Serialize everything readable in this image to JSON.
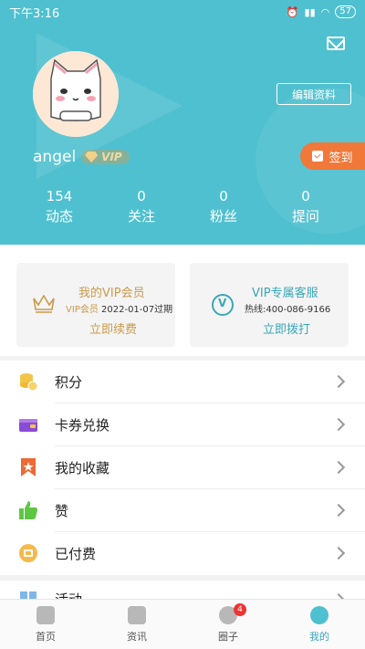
{
  "status_bar": {
    "time": "下午3:16",
    "battery": "57"
  },
  "header": {
    "edit_profile_label": "编辑资料",
    "signin_label": "签到",
    "username": "angel",
    "vip_label": "VIP",
    "stats": [
      {
        "value": "154",
        "label": "动态"
      },
      {
        "value": "0",
        "label": "关注"
      },
      {
        "value": "0",
        "label": "粉丝"
      },
      {
        "value": "0",
        "label": "提问"
      }
    ]
  },
  "vip_card": {
    "title": "我的VIP会员",
    "member_label": "VIP会员",
    "expiry": "2022-01-07过期",
    "action": "立即续费"
  },
  "service_card": {
    "title": "VIP专属客服",
    "hotline": "热线:400-086-9166",
    "action": "立即拨打"
  },
  "menu_items": [
    {
      "label": "积分",
      "icon": "coins-icon",
      "color": "#f3c44a"
    },
    {
      "label": "卡券兑换",
      "icon": "wallet-icon",
      "color": "#8a4bd6"
    },
    {
      "label": "我的收藏",
      "icon": "bookmark-star-icon",
      "color": "#ee6a34"
    },
    {
      "label": "赞",
      "icon": "thumbs-up-icon",
      "color": "#5ec642"
    },
    {
      "label": "已付费",
      "icon": "paid-icon",
      "color": "#f3b94a"
    }
  ],
  "next_section_label": "活动",
  "bottom_nav": [
    {
      "label": "首页",
      "icon": "home-icon"
    },
    {
      "label": "资讯",
      "icon": "news-icon"
    },
    {
      "label": "圈子",
      "icon": "circle-chat-icon",
      "badge": "4"
    },
    {
      "label": "我的",
      "icon": "profile-icon",
      "active": true
    }
  ],
  "colors": {
    "primary": "#4fc0cf",
    "accent_orange": "#f0793a",
    "gold": "#c99a4b"
  }
}
